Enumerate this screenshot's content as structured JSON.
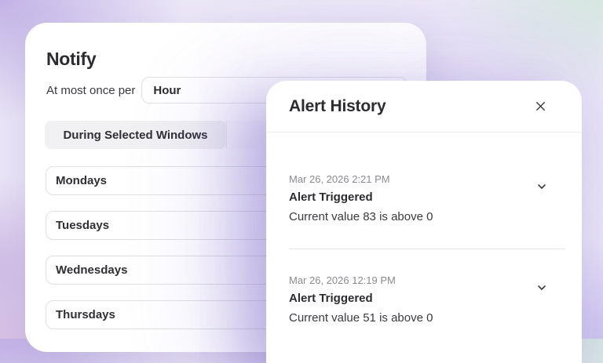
{
  "notify_card": {
    "title": "Notify",
    "frequency_label": "At most once per",
    "frequency_value": "Hour",
    "tabs": [
      {
        "label": "During Selected Windows",
        "active": true
      },
      {
        "label": "",
        "active": false
      }
    ],
    "days": [
      "Mondays",
      "Tuesdays",
      "Wednesdays",
      "Thursdays"
    ]
  },
  "alert_history": {
    "title": "Alert History",
    "entries": [
      {
        "timestamp": "Mar 26, 2026 2:21 PM",
        "title": "Alert Triggered",
        "description": "Current value 83 is above 0"
      },
      {
        "timestamp": "Mar 26, 2026 12:19 PM",
        "title": "Alert Triggered",
        "description": "Current value 51 is above 0"
      }
    ]
  },
  "icons": {
    "close": "x-icon",
    "entry_expand": "chevron-down-icon"
  },
  "colors": {
    "background_lavender": "#c2b2e6",
    "background_mint": "#d3e8dc",
    "background_rose": "#d9bfe2",
    "card_background": "#ffffff",
    "text_primary": "#2c2c30",
    "text_secondary": "#8a8a90",
    "border": "#e0e0e5",
    "tab_active_background": "#f1f1f3",
    "panel_shadow": "rgba(104,82,190,0.30)"
  }
}
